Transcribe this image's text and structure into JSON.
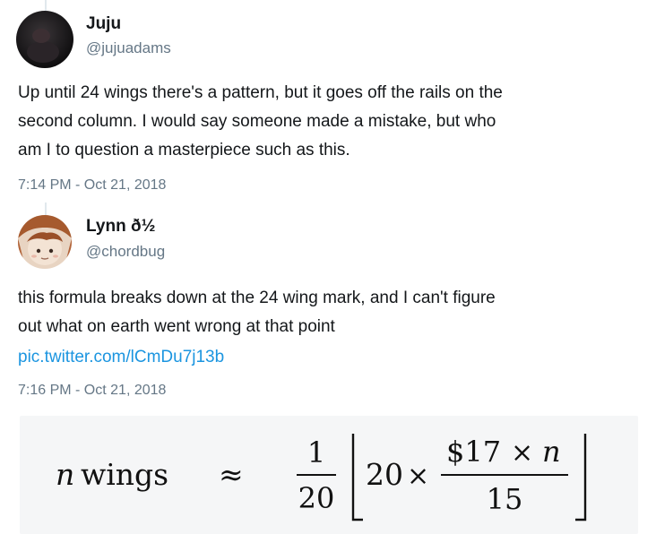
{
  "tweets": [
    {
      "name": "Juju",
      "handle": "@jujuadams",
      "lines": [
        "Up until 24 wings there's a pattern, but it goes off the rails on the",
        "second column. I would say someone made a mistake, but who",
        "am I to question a masterpiece such as this."
      ],
      "timestamp": "7:14 PM - Oct 21, 2018"
    },
    {
      "name": "Lynn ð½",
      "handle": "@chordbug",
      "lines": [
        "this formula breaks down at the 24 wing mark, and I can't figure",
        "out what on earth went wrong at that point"
      ],
      "link": "pic.twitter.com/lCmDu7j13b",
      "timestamp": "7:16 PM - Oct 21, 2018"
    }
  ],
  "formula": {
    "lhs_var": "n",
    "lhs_word": "wings",
    "approx": "≈",
    "frac1_num": "1",
    "frac1_den": "20",
    "mult_a": "20",
    "times": "×",
    "frac2_num_dollar": "$17",
    "frac2_num_var": "n",
    "frac2_den": "15"
  },
  "colors": {
    "text": "#14171a",
    "secondary": "#657786",
    "link": "#1b95e0",
    "formula_bg": "#f5f6f7"
  }
}
